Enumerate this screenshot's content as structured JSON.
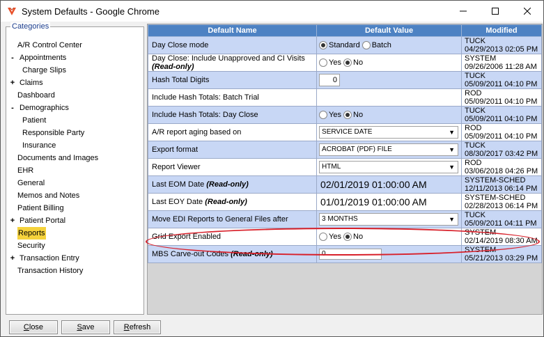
{
  "window": {
    "title": "System Defaults - Google Chrome",
    "brand_color": "#e8502a"
  },
  "categories": {
    "legend": "Categories",
    "items": [
      {
        "label": "A/R Control Center",
        "level": 0,
        "expander": ""
      },
      {
        "label": "Appointments",
        "level": 0,
        "expander": "-"
      },
      {
        "label": "Charge Slips",
        "level": 1,
        "expander": ""
      },
      {
        "label": "Claims",
        "level": 0,
        "expander": "+"
      },
      {
        "label": "Dashboard",
        "level": 0,
        "expander": ""
      },
      {
        "label": "Demographics",
        "level": 0,
        "expander": "-"
      },
      {
        "label": "Patient",
        "level": 1,
        "expander": ""
      },
      {
        "label": "Responsible Party",
        "level": 1,
        "expander": ""
      },
      {
        "label": "Insurance",
        "level": 1,
        "expander": ""
      },
      {
        "label": "Documents and Images",
        "level": 0,
        "expander": ""
      },
      {
        "label": "EHR",
        "level": 0,
        "expander": ""
      },
      {
        "label": "General",
        "level": 0,
        "expander": ""
      },
      {
        "label": "Memos and Notes",
        "level": 0,
        "expander": ""
      },
      {
        "label": "Patient Billing",
        "level": 0,
        "expander": ""
      },
      {
        "label": "Patient Portal",
        "level": 0,
        "expander": "+"
      },
      {
        "label": "Reports",
        "level": 0,
        "expander": "",
        "selected": true
      },
      {
        "label": "Security",
        "level": 0,
        "expander": ""
      },
      {
        "label": "Transaction Entry",
        "level": 0,
        "expander": "+"
      },
      {
        "label": "Transaction History",
        "level": 0,
        "expander": ""
      }
    ]
  },
  "grid": {
    "headers": {
      "name": "Default Name",
      "value": "Default Value",
      "modified": "Modified"
    },
    "header_color": "#4d82c3",
    "rows": [
      {
        "name": "Day Close mode",
        "readonly": "",
        "type": "radio",
        "options": [
          "Standard",
          "Batch"
        ],
        "selected": 0,
        "mod_user": "TUCK",
        "mod_date": "04/29/2013 02:05 PM"
      },
      {
        "name": "Day Close: Include Unapproved and CI Visits",
        "readonly": "(Read-only)",
        "type": "radio",
        "options": [
          "Yes",
          "No"
        ],
        "selected": 1,
        "mod_user": "SYSTEM",
        "mod_date": "09/26/2006 11:28 AM"
      },
      {
        "name": "Hash Total Digits",
        "readonly": "",
        "type": "number",
        "value": "0",
        "mod_user": "TUCK",
        "mod_date": "05/09/2011 04:10 PM"
      },
      {
        "name": "Include Hash Totals: Batch Trial",
        "readonly": "",
        "type": "none",
        "mod_user": "ROD",
        "mod_date": "05/09/2011 04:10 PM"
      },
      {
        "name": "Include Hash Totals: Day Close",
        "readonly": "",
        "type": "radio",
        "options": [
          "Yes",
          "No"
        ],
        "selected": 1,
        "mod_user": "TUCK",
        "mod_date": "05/09/2011 04:10 PM"
      },
      {
        "name": "A/R report aging based on",
        "readonly": "",
        "type": "select",
        "value": "SERVICE DATE",
        "mod_user": "ROD",
        "mod_date": "05/09/2011 04:10 PM"
      },
      {
        "name": "Export format",
        "readonly": "",
        "type": "select",
        "value": "ACROBAT (PDF) FILE",
        "mod_user": "TUCK",
        "mod_date": "08/30/2017 03:42 PM"
      },
      {
        "name": "Report Viewer",
        "readonly": "",
        "type": "select",
        "value": "HTML",
        "mod_user": "ROD",
        "mod_date": "03/06/2018 04:26 PM"
      },
      {
        "name": "Last EOM Date",
        "readonly": "(Read-only)",
        "type": "date",
        "value": "02/01/2019 01:00:00 AM",
        "mod_user": "SYSTEM-SCHED",
        "mod_date": "12/11/2013 06:14 PM"
      },
      {
        "name": "Last EOY Date",
        "readonly": "(Read-only)",
        "type": "date",
        "value": "01/01/2019 01:00:00 AM",
        "mod_user": "SYSTEM-SCHED",
        "mod_date": "02/28/2013 06:14 PM"
      },
      {
        "name": "Move EDI Reports to General Files after",
        "readonly": "",
        "type": "select",
        "value": "3 MONTHS",
        "mod_user": "TUCK",
        "mod_date": "05/09/2011 04:11 PM"
      },
      {
        "name": "Grid Export Enabled",
        "readonly": "",
        "type": "radio",
        "options": [
          "Yes",
          "No"
        ],
        "selected": 1,
        "mod_user": "SYSTEM",
        "mod_date": "02/14/2019 08:30 AM"
      },
      {
        "name": "MBS Carve-out Codes",
        "readonly": "(Read-only)",
        "type": "text",
        "value": "0",
        "mod_user": "SYSTEM",
        "mod_date": "05/21/2013 03:29 PM"
      }
    ]
  },
  "buttons": {
    "close": {
      "first": "C",
      "rest": "lose"
    },
    "save": {
      "first": "S",
      "rest": "ave"
    },
    "refresh": {
      "first": "R",
      "rest": "efresh"
    }
  }
}
